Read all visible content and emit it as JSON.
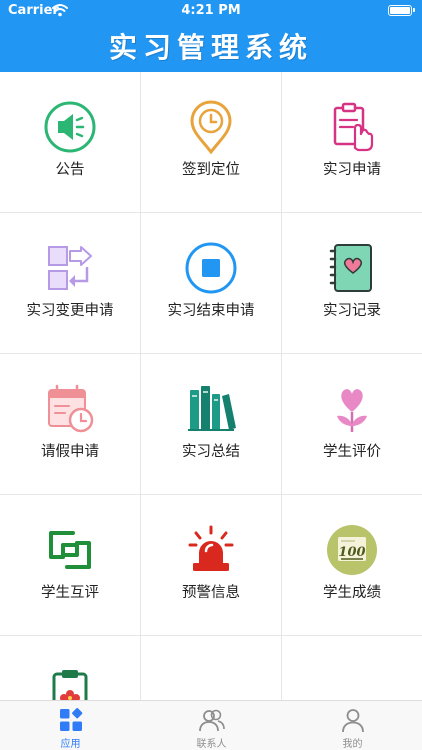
{
  "status_bar": {
    "carrier": "Carrier",
    "time": "4:21 PM"
  },
  "header": {
    "title": "实习管理系统"
  },
  "grid": {
    "items": [
      {
        "label": "公告",
        "icon": "speaker-icon"
      },
      {
        "label": "签到定位",
        "icon": "location-clock-icon"
      },
      {
        "label": "实习申请",
        "icon": "clipboard-hand-icon"
      },
      {
        "label": "实习变更申请",
        "icon": "swap-arrows-icon"
      },
      {
        "label": "实习结束申请",
        "icon": "stop-icon"
      },
      {
        "label": "实习记录",
        "icon": "notebook-heart-icon"
      },
      {
        "label": "请假申请",
        "icon": "calendar-clock-icon"
      },
      {
        "label": "实习总结",
        "icon": "books-icon"
      },
      {
        "label": "学生评价",
        "icon": "flower-icon"
      },
      {
        "label": "学生互评",
        "icon": "mutual-squares-icon"
      },
      {
        "label": "预警信息",
        "icon": "siren-icon"
      },
      {
        "label": "学生成绩",
        "icon": "score-100-icon"
      },
      {
        "label": "",
        "icon": "clipboard-flower-icon"
      }
    ]
  },
  "tabbar": {
    "tabs": [
      {
        "label": "应用",
        "icon": "apps-icon",
        "active": true
      },
      {
        "label": "联系人",
        "icon": "contacts-icon",
        "active": false
      },
      {
        "label": "我的",
        "icon": "profile-icon",
        "active": false
      }
    ]
  },
  "colors": {
    "primary": "#2196f3",
    "tab_active": "#2f7cf6",
    "tab_inactive": "#8e8e8e"
  }
}
